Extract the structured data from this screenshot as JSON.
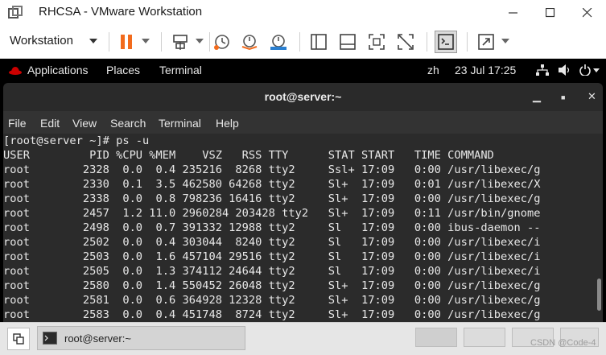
{
  "window": {
    "title": "RHCSA - VMware Workstation",
    "controls": [
      "minimize-icon",
      "maximize-icon",
      "close-icon"
    ]
  },
  "toolbar": {
    "menu_label": "Workstation",
    "icons": [
      "pause-icon",
      "send-keys-icon",
      "snapshot-icon",
      "revert-snapshot-icon",
      "snapshot-manager-icon",
      "sidebar-icon",
      "thumbnail-icon",
      "fullscreen-icon",
      "unity-icon",
      "console-icon",
      "stretch-icon"
    ]
  },
  "gnome_topbar": {
    "applications": "Applications",
    "places": "Places",
    "terminal": "Terminal",
    "input_method": "zh",
    "datetime": "23 Jul  17:25"
  },
  "terminal": {
    "title": "root@server:~",
    "menu": [
      "File",
      "Edit",
      "View",
      "Search",
      "Terminal",
      "Help"
    ],
    "lines": [
      "[root@server ~]# ps -u",
      "USER         PID %CPU %MEM    VSZ   RSS TTY      STAT START   TIME COMMAND",
      "root        2328  0.0  0.4 235216  8268 tty2     Ssl+ 17:09   0:00 /usr/libexec/g",
      "root        2330  0.1  3.5 462580 64268 tty2     Sl+  17:09   0:01 /usr/libexec/X",
      "root        2338  0.0  0.8 798236 16416 tty2     Sl+  17:09   0:00 /usr/libexec/g",
      "root        2457  1.2 11.0 2960284 203428 tty2   Sl+  17:09   0:11 /usr/bin/gnome",
      "root        2498  0.0  0.7 391332 12988 tty2     Sl   17:09   0:00 ibus-daemon --",
      "root        2502  0.0  0.4 303044  8240 tty2     Sl   17:09   0:00 /usr/libexec/i",
      "root        2503  0.0  1.6 457104 29516 tty2     Sl   17:09   0:00 /usr/libexec/i",
      "root        2505  0.0  1.3 374112 24644 tty2     Sl   17:09   0:00 /usr/libexec/i",
      "root        2580  0.0  1.4 550452 26048 tty2     Sl+  17:09   0:00 /usr/libexec/g",
      "root        2581  0.0  0.6 364928 12328 tty2     Sl+  17:09   0:00 /usr/libexec/g",
      "root        2583  0.0  0.4 451748  8724 tty2     Sl+  17:09   0:00 /usr/libexec/g"
    ]
  },
  "taskbar": {
    "task_label": "root@server:~",
    "watermark": "CSDN @Code-4"
  },
  "colors": {
    "pause_accent": "#f26b1d",
    "terminal_bg": "#2b2b2b",
    "terminal_header": "#2a2a2a"
  }
}
